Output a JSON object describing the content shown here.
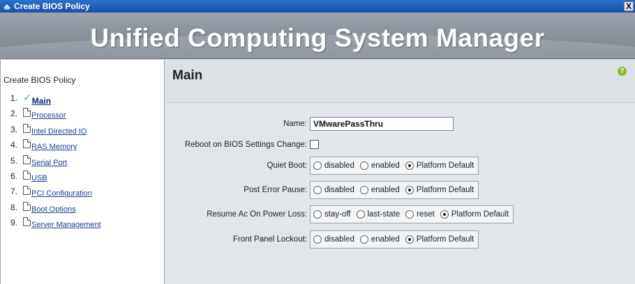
{
  "window": {
    "title": "Create BIOS Policy",
    "close_label": "X"
  },
  "banner": {
    "title": "Unified Computing System Manager"
  },
  "wizard": {
    "heading": "Create BIOS Policy",
    "steps": [
      {
        "num": "1.",
        "label": "Main",
        "status": "completed"
      },
      {
        "num": "2.",
        "label": "Processor",
        "status": "pending"
      },
      {
        "num": "3.",
        "label": "Intel Directed IO",
        "status": "pending"
      },
      {
        "num": "4.",
        "label": "RAS Memory",
        "status": "pending"
      },
      {
        "num": "5.",
        "label": "Serial Port",
        "status": "pending"
      },
      {
        "num": "6.",
        "label": "USB",
        "status": "pending"
      },
      {
        "num": "7.",
        "label": "PCI Configuration",
        "status": "pending"
      },
      {
        "num": "8.",
        "label": "Boot Options",
        "status": "pending"
      },
      {
        "num": "9.",
        "label": "Server Management",
        "status": "pending"
      }
    ]
  },
  "main": {
    "title": "Main",
    "help_icon": "help-icon",
    "fields": {
      "name": {
        "label": "Name:",
        "value": "VMwarePassThru"
      },
      "reboot": {
        "label": "Reboot on BIOS Settings Change:",
        "checked": false
      },
      "quiet_boot": {
        "label": "Quiet Boot:",
        "options": [
          "disabled",
          "enabled",
          "Platform Default"
        ],
        "selected": "Platform Default"
      },
      "post_error_pause": {
        "label": "Post Error Pause:",
        "options": [
          "disabled",
          "enabled",
          "Platform Default"
        ],
        "selected": "Platform Default"
      },
      "resume_ac": {
        "label": "Resume Ac On Power Loss:",
        "options": [
          "stay-off",
          "last-state",
          "reset",
          "Platform Default"
        ],
        "selected": "Platform Default"
      },
      "front_panel_lockout": {
        "label": "Front Panel Lockout:",
        "options": [
          "disabled",
          "enabled",
          "Platform Default"
        ],
        "selected": "Platform Default"
      }
    }
  },
  "colors": {
    "titlebar": "#1c4fa4",
    "banner": "#8b949c",
    "link": "#1a3d8f",
    "check": "#3cba3c",
    "help": "#8bbb2a"
  }
}
